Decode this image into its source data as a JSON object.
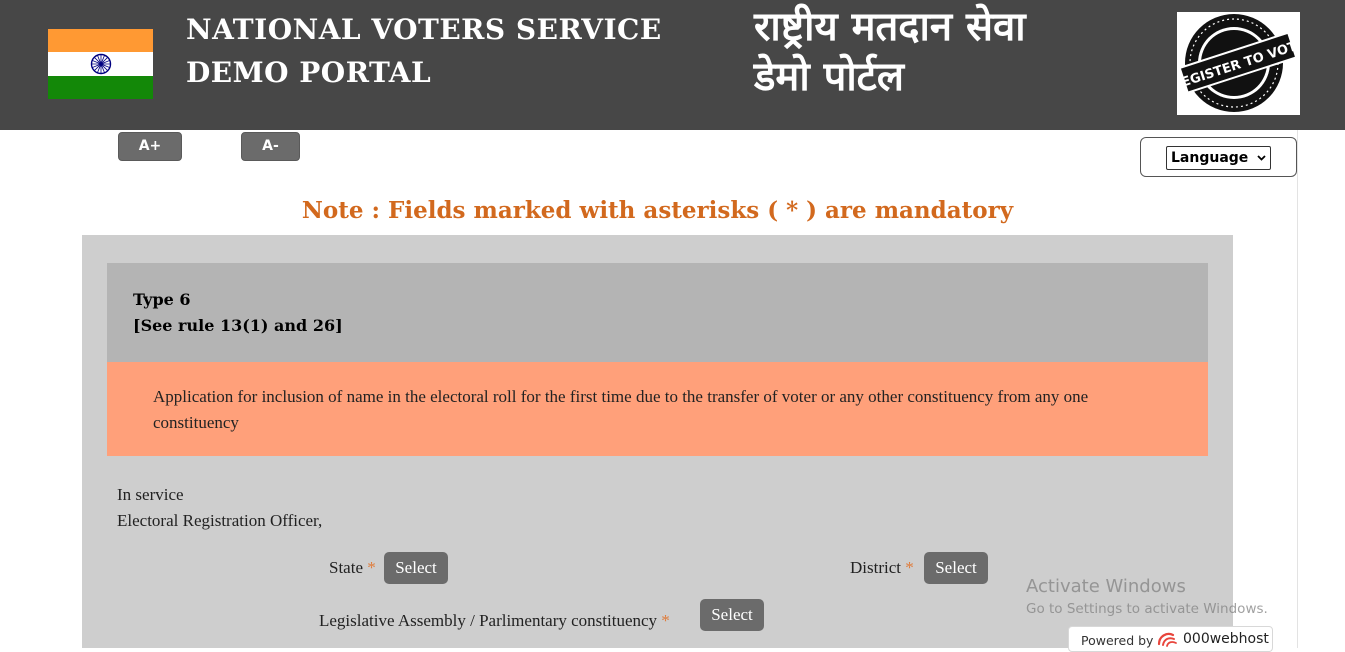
{
  "header": {
    "title_en_line1": "NATIONAL VOTERS SERVICE",
    "title_en_line2": "DEMO PORTAL",
    "title_hi_line1": "राष्ट्रीय मतदान सेवा",
    "title_hi_line2": "डेमो पोर्टल",
    "logo_text": "REGISTER TO VOTE",
    "bg_color": "#474747"
  },
  "toolbar": {
    "font_increase": "A+",
    "font_decrease": "A-",
    "language_select": "Language"
  },
  "note": "Note : Fields marked with asterisks ( * ) are mandatory",
  "form": {
    "type_title": "Type 6",
    "type_rule": "[See rule 13(1) and 26]",
    "application_text": "Application for inclusion of name in the electoral roll for the first time due to the transfer of voter or any other constituency from any one constituency",
    "addressee_line1": "In service",
    "addressee_line2": "Electoral Registration Officer,",
    "fields": {
      "state_label": "State",
      "district_label": "District",
      "constituency_label": "Legislative Assembly / Parlimentary constituency",
      "asterisk": "*",
      "select_label": "Select"
    }
  },
  "watermark": {
    "line1": "Activate Windows",
    "line2": "Go to Settings to activate Windows."
  },
  "powered_by": {
    "prefix": "Powered by",
    "host": "000webhost"
  },
  "colors": {
    "note": "#d2691e",
    "panel": "#cecece",
    "type_box": "#b4b4b4",
    "app_box": "#ffa07a",
    "button": "#6b6b6b"
  }
}
